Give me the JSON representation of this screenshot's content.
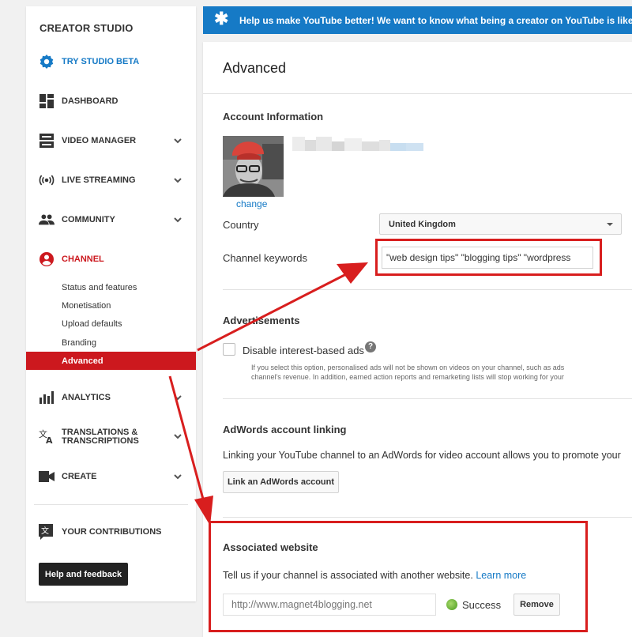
{
  "sidebar": {
    "title": "CREATOR STUDIO",
    "items": [
      {
        "label": "TRY STUDIO BETA",
        "icon": "gear-icon"
      },
      {
        "label": "DASHBOARD",
        "icon": "dashboard-icon"
      },
      {
        "label": "VIDEO MANAGER",
        "icon": "video-manager-icon"
      },
      {
        "label": "LIVE STREAMING",
        "icon": "live-streaming-icon"
      },
      {
        "label": "COMMUNITY",
        "icon": "community-icon"
      },
      {
        "label": "CHANNEL",
        "icon": "channel-icon"
      },
      {
        "label": "ANALYTICS",
        "icon": "analytics-icon"
      },
      {
        "label": "TRANSLATIONS & TRANSCRIPTIONS",
        "icon": "translate-icon"
      },
      {
        "label": "CREATE",
        "icon": "create-icon"
      },
      {
        "label": "YOUR CONTRIBUTIONS",
        "icon": "contributions-icon"
      }
    ],
    "channel_subitems": [
      "Status and features",
      "Monetisation",
      "Upload defaults",
      "Branding",
      "Advanced"
    ],
    "help_button": "Help and feedback",
    "accent_color": "#cc181e",
    "beta_color": "#167ac6"
  },
  "banner": {
    "text": "Help us make YouTube better! We want to know what being a creator on YouTube is like",
    "color": "#167ac6"
  },
  "main": {
    "title": "Advanced",
    "account_information": {
      "heading": "Account Information",
      "change_link": "change",
      "country_label": "Country",
      "country_value": "United Kingdom",
      "keywords_label": "Channel keywords",
      "keywords_value": "\"web design tips\" \"blogging tips\" \"wordpress"
    },
    "advertisements": {
      "heading": "Advertisements",
      "checkbox_label": "Disable interest-based ads",
      "note_line1": "If you select this option, personalised ads will not be shown on videos on your channel, such as ads",
      "note_line2": "channel's revenue. In addition, earned action reports and remarketing lists will stop working for your"
    },
    "adwords": {
      "heading": "AdWords account linking",
      "description": "Linking your YouTube channel to an AdWords for video account allows you to promote your",
      "button": "Link an AdWords account"
    },
    "associated_website": {
      "heading": "Associated website",
      "description": "Tell us if your channel is associated with another website.",
      "learn_more": "Learn more",
      "url_placeholder": "http://www.magnet4blogging.net",
      "status": "Success",
      "status_color": "#4a9a1f",
      "remove_button": "Remove"
    }
  },
  "annotation_color": "#d81e1e"
}
